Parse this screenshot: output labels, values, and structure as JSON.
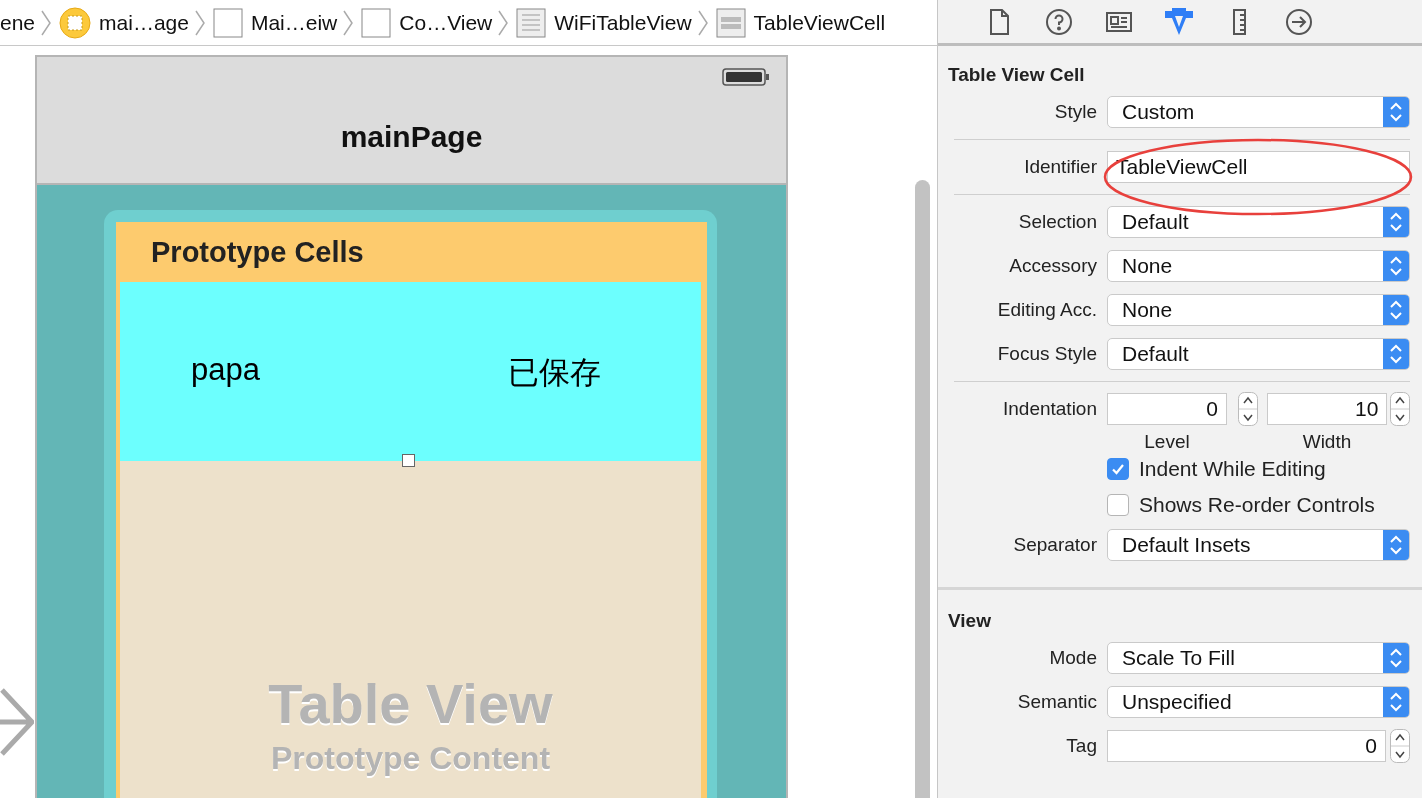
{
  "breadcrumb": [
    {
      "label": "ene",
      "kind": "text"
    },
    {
      "label": "mai…age",
      "kind": "storyboard"
    },
    {
      "label": "Mai…eiw",
      "kind": "view"
    },
    {
      "label": "Co…View",
      "kind": "view"
    },
    {
      "label": "WiFiTableView",
      "kind": "table"
    },
    {
      "label": "TableViewCell",
      "kind": "cell"
    }
  ],
  "canvas": {
    "nav_title": "mainPage",
    "table_header": "Prototype Cells",
    "cell": {
      "title": "papa",
      "status": "已保存"
    },
    "placeholder": {
      "title": "Table View",
      "subtitle": "Prototype Content"
    }
  },
  "inspector": {
    "tabs": [
      {
        "kind": "file",
        "selected": false
      },
      {
        "kind": "help",
        "selected": false
      },
      {
        "kind": "identity",
        "selected": false
      },
      {
        "kind": "attributes",
        "selected": true
      },
      {
        "kind": "size",
        "selected": false
      },
      {
        "kind": "connections",
        "selected": false
      }
    ],
    "sections": [
      {
        "title": "Table View Cell",
        "rows": [
          {
            "kind": "popup",
            "label": "Style",
            "value": "Custom"
          },
          {
            "kind": "divider"
          },
          {
            "kind": "field",
            "label": "Identifier",
            "value": "TableViewCell",
            "annotated": true
          },
          {
            "kind": "divider"
          },
          {
            "kind": "popup",
            "label": "Selection",
            "value": "Default"
          },
          {
            "kind": "popup",
            "label": "Accessory",
            "value": "None"
          },
          {
            "kind": "popup",
            "label": "Editing Acc.",
            "value": "None"
          },
          {
            "kind": "popup",
            "label": "Focus Style",
            "value": "Default"
          },
          {
            "kind": "divider"
          },
          {
            "kind": "steppers",
            "label": "Indentation",
            "fields": [
              {
                "value": "0",
                "caption": "Level"
              },
              {
                "value": "10",
                "caption": "Width"
              }
            ]
          },
          {
            "kind": "checkbox",
            "label": "Indent While Editing",
            "checked": true
          },
          {
            "kind": "checkbox",
            "label": "Shows Re-order Controls",
            "checked": false
          },
          {
            "kind": "popup",
            "label": "Separator",
            "value": "Default Insets"
          }
        ]
      },
      {
        "title": "View",
        "rows": [
          {
            "kind": "popup",
            "label": "Mode",
            "value": "Scale To Fill"
          },
          {
            "kind": "popup",
            "label": "Semantic",
            "value": "Unspecified"
          },
          {
            "kind": "number",
            "label": "Tag",
            "value": "0"
          }
        ]
      }
    ]
  }
}
